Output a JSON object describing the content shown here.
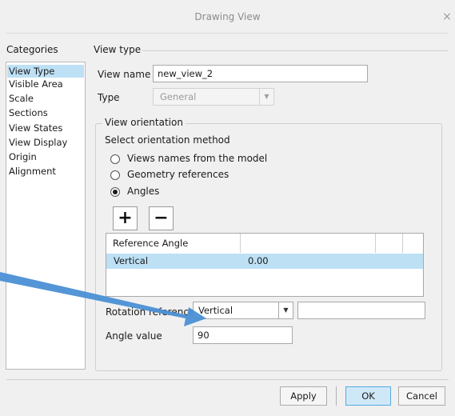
{
  "window": {
    "title": "Drawing View",
    "close_glyph": "×"
  },
  "categories": {
    "title": "Categories",
    "items": [
      "View Type",
      "Visible Area",
      "Scale",
      "Sections",
      "View States",
      "View Display",
      "Origin",
      "Alignment"
    ],
    "selected": "View Type"
  },
  "view_type": {
    "title": "View type",
    "view_name_label": "View name",
    "view_name_value": "new_view_2",
    "type_label": "Type",
    "type_value": "General"
  },
  "orientation": {
    "title": "View orientation",
    "method_label": "Select orientation method",
    "options": [
      "Views names from the model",
      "Geometry references",
      "Angles"
    ],
    "selected": "Angles",
    "add_glyph": "+",
    "remove_glyph": "−",
    "table": {
      "header": "Reference Angle",
      "rows": [
        {
          "reference": "Vertical",
          "angle": "0.00"
        }
      ]
    },
    "rotation_label": "Rotation reference",
    "rotation_value": "Vertical",
    "angle_label": "Angle value",
    "angle_value": "90"
  },
  "buttons": {
    "apply": "Apply",
    "ok": "OK",
    "cancel": "Cancel"
  },
  "colors": {
    "selection": "#bde0f5",
    "annotation_arrow": "#4a8fd4",
    "ok_button": "#cfe8f8"
  },
  "icons": [
    "close-icon",
    "add-icon",
    "remove-icon",
    "dropdown-arrow-icon",
    "radio-icon",
    "annotation-arrow"
  ]
}
